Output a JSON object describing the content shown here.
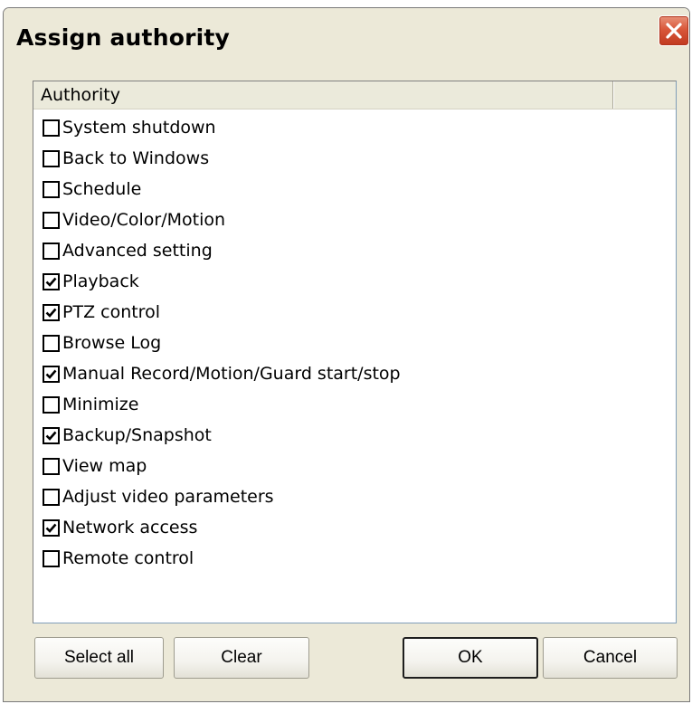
{
  "window": {
    "title": "Assign authority",
    "close_icon": "close-icon"
  },
  "list": {
    "column_header": "Authority",
    "extra_column_header": "",
    "items": [
      {
        "label": "System shutdown",
        "checked": false
      },
      {
        "label": "Back to Windows",
        "checked": false
      },
      {
        "label": "Schedule",
        "checked": false
      },
      {
        "label": "Video/Color/Motion",
        "checked": false
      },
      {
        "label": "Advanced setting",
        "checked": false
      },
      {
        "label": "Playback",
        "checked": true
      },
      {
        "label": "PTZ control",
        "checked": true
      },
      {
        "label": "Browse Log",
        "checked": false
      },
      {
        "label": "Manual Record/Motion/Guard start/stop",
        "checked": true
      },
      {
        "label": "Minimize",
        "checked": false
      },
      {
        "label": "Backup/Snapshot",
        "checked": true
      },
      {
        "label": "View map",
        "checked": false
      },
      {
        "label": "Adjust video parameters",
        "checked": false
      },
      {
        "label": "Network access",
        "checked": true
      },
      {
        "label": "Remote control",
        "checked": false
      }
    ]
  },
  "buttons": {
    "select_all": "Select all",
    "clear": "Clear",
    "ok": "OK",
    "cancel": "Cancel"
  },
  "colors": {
    "dialog_background": "#ece9d8",
    "close_button": "#d9573a",
    "list_border": "#7f9db9"
  }
}
